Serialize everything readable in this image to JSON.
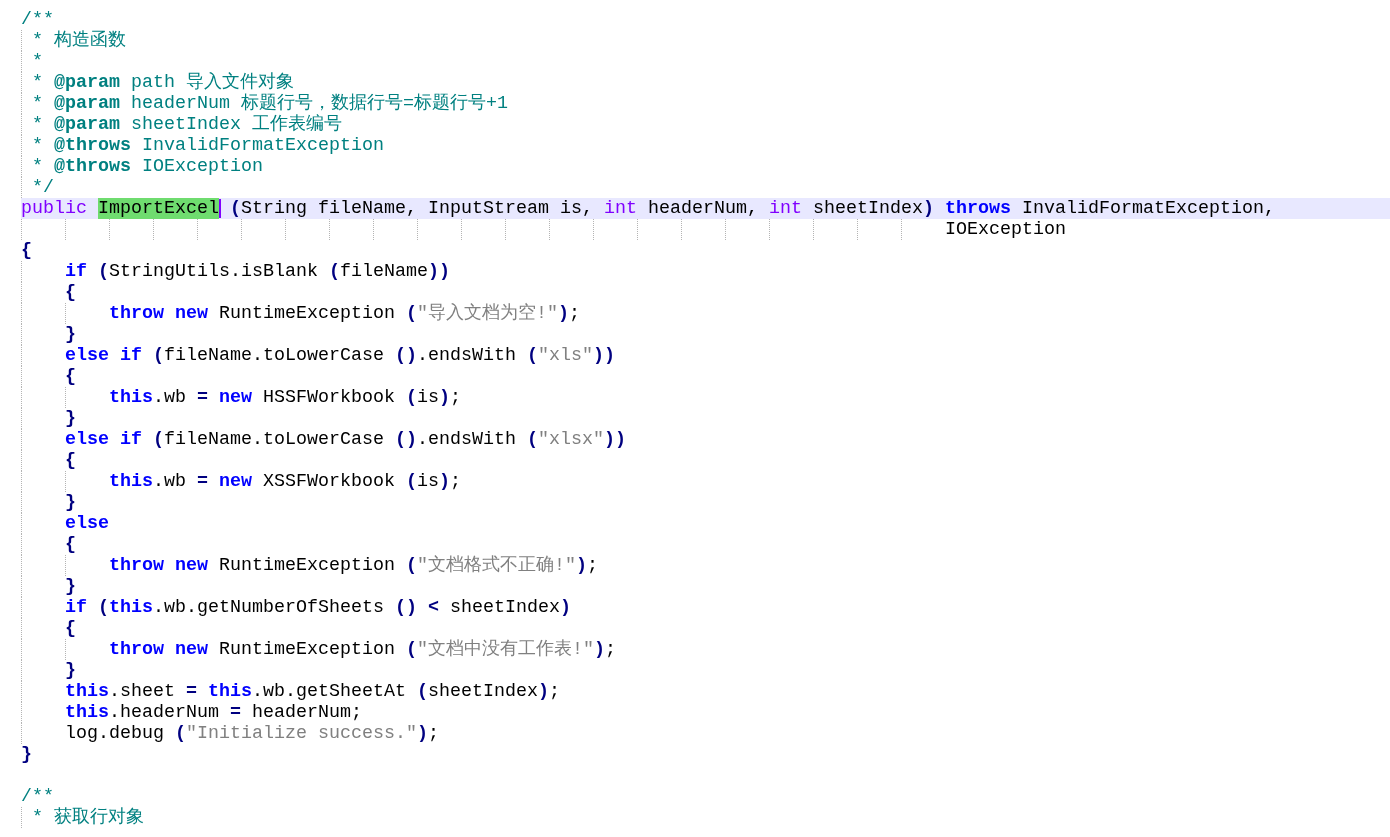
{
  "lines": [
    {
      "current": false,
      "tokens": [
        {
          "text": "/**",
          "kind": "comment"
        }
      ]
    },
    {
      "current": false,
      "tokens": [
        {
          "text": " * 构造函数",
          "kind": "comment"
        }
      ]
    },
    {
      "current": false,
      "tokens": [
        {
          "text": " *",
          "kind": "comment"
        }
      ]
    },
    {
      "current": false,
      "tokens": [
        {
          "text": " * ",
          "kind": "comment"
        },
        {
          "text": "@param",
          "kind": "tag"
        },
        {
          "text": " path 导入文件对象",
          "kind": "comment"
        }
      ]
    },
    {
      "current": false,
      "tokens": [
        {
          "text": " * ",
          "kind": "comment"
        },
        {
          "text": "@param",
          "kind": "tag"
        },
        {
          "text": " headerNum 标题行号，数据行号=标题行号+1",
          "kind": "comment"
        }
      ]
    },
    {
      "current": false,
      "tokens": [
        {
          "text": " * ",
          "kind": "comment"
        },
        {
          "text": "@param",
          "kind": "tag"
        },
        {
          "text": " sheetIndex 工作表编号",
          "kind": "comment"
        }
      ]
    },
    {
      "current": false,
      "tokens": [
        {
          "text": " * ",
          "kind": "comment"
        },
        {
          "text": "@throws",
          "kind": "tag"
        },
        {
          "text": " InvalidFormatException",
          "kind": "comment"
        }
      ]
    },
    {
      "current": false,
      "tokens": [
        {
          "text": " * ",
          "kind": "comment"
        },
        {
          "text": "@throws",
          "kind": "tag"
        },
        {
          "text": " IOException",
          "kind": "comment"
        }
      ]
    },
    {
      "current": false,
      "tokens": [
        {
          "text": " */",
          "kind": "comment"
        }
      ]
    },
    {
      "current": true,
      "tokens": [
        {
          "text": "public ",
          "kind": "type"
        },
        {
          "text": "ImportExcel",
          "kind": "match",
          "caret": true
        },
        {
          "text": " (",
          "kind": "op"
        },
        {
          "text": "String fileName, InputStream is, ",
          "kind": "plain"
        },
        {
          "text": "int",
          "kind": "type"
        },
        {
          "text": " headerNum, ",
          "kind": "plain"
        },
        {
          "text": "int",
          "kind": "type"
        },
        {
          "text": " sheetIndex",
          "kind": "plain"
        },
        {
          "text": ") ",
          "kind": "op"
        },
        {
          "text": "throws",
          "kind": "kw"
        },
        {
          "text": " InvalidFormatException,",
          "kind": "plain"
        }
      ]
    },
    {
      "current": false,
      "tokens": [
        {
          "text": "                                                                                    IOException",
          "kind": "plain"
        }
      ]
    },
    {
      "current": false,
      "tokens": [
        {
          "text": "{",
          "kind": "op"
        }
      ]
    },
    {
      "current": false,
      "tokens": [
        {
          "text": "    if ",
          "kind": "kw"
        },
        {
          "text": "(",
          "kind": "op"
        },
        {
          "text": "StringUtils.isBlank ",
          "kind": "plain"
        },
        {
          "text": "(",
          "kind": "op"
        },
        {
          "text": "fileName",
          "kind": "plain"
        },
        {
          "text": "))",
          "kind": "op"
        }
      ]
    },
    {
      "current": false,
      "tokens": [
        {
          "text": "    {",
          "kind": "op"
        }
      ]
    },
    {
      "current": false,
      "tokens": [
        {
          "text": "        throw new",
          "kind": "kw"
        },
        {
          "text": " RuntimeException ",
          "kind": "plain"
        },
        {
          "text": "(",
          "kind": "op"
        },
        {
          "text": "\"导入文档为空!\"",
          "kind": "str"
        },
        {
          "text": ")",
          "kind": "op"
        },
        {
          "text": ";",
          "kind": "plain"
        }
      ]
    },
    {
      "current": false,
      "tokens": [
        {
          "text": "    }",
          "kind": "op"
        }
      ]
    },
    {
      "current": false,
      "tokens": [
        {
          "text": "    else if ",
          "kind": "kw"
        },
        {
          "text": "(",
          "kind": "op"
        },
        {
          "text": "fileName.toLowerCase ",
          "kind": "plain"
        },
        {
          "text": "()",
          "kind": "op"
        },
        {
          "text": ".endsWith ",
          "kind": "plain"
        },
        {
          "text": "(",
          "kind": "op"
        },
        {
          "text": "\"xls\"",
          "kind": "str"
        },
        {
          "text": "))",
          "kind": "op"
        }
      ]
    },
    {
      "current": false,
      "tokens": [
        {
          "text": "    {",
          "kind": "op"
        }
      ]
    },
    {
      "current": false,
      "tokens": [
        {
          "text": "        this",
          "kind": "kw"
        },
        {
          "text": ".wb ",
          "kind": "plain"
        },
        {
          "text": "= ",
          "kind": "op"
        },
        {
          "text": "new",
          "kind": "kw"
        },
        {
          "text": " HSSFWorkbook ",
          "kind": "plain"
        },
        {
          "text": "(",
          "kind": "op"
        },
        {
          "text": "is",
          "kind": "plain"
        },
        {
          "text": ")",
          "kind": "op"
        },
        {
          "text": ";",
          "kind": "plain"
        }
      ]
    },
    {
      "current": false,
      "tokens": [
        {
          "text": "    }",
          "kind": "op"
        }
      ]
    },
    {
      "current": false,
      "tokens": [
        {
          "text": "    else if ",
          "kind": "kw"
        },
        {
          "text": "(",
          "kind": "op"
        },
        {
          "text": "fileName.toLowerCase ",
          "kind": "plain"
        },
        {
          "text": "()",
          "kind": "op"
        },
        {
          "text": ".endsWith ",
          "kind": "plain"
        },
        {
          "text": "(",
          "kind": "op"
        },
        {
          "text": "\"xlsx\"",
          "kind": "str"
        },
        {
          "text": "))",
          "kind": "op"
        }
      ]
    },
    {
      "current": false,
      "tokens": [
        {
          "text": "    {",
          "kind": "op"
        }
      ]
    },
    {
      "current": false,
      "tokens": [
        {
          "text": "        this",
          "kind": "kw"
        },
        {
          "text": ".wb ",
          "kind": "plain"
        },
        {
          "text": "= ",
          "kind": "op"
        },
        {
          "text": "new",
          "kind": "kw"
        },
        {
          "text": " XSSFWorkbook ",
          "kind": "plain"
        },
        {
          "text": "(",
          "kind": "op"
        },
        {
          "text": "is",
          "kind": "plain"
        },
        {
          "text": ")",
          "kind": "op"
        },
        {
          "text": ";",
          "kind": "plain"
        }
      ]
    },
    {
      "current": false,
      "tokens": [
        {
          "text": "    }",
          "kind": "op"
        }
      ]
    },
    {
      "current": false,
      "tokens": [
        {
          "text": "    else",
          "kind": "kw"
        }
      ]
    },
    {
      "current": false,
      "tokens": [
        {
          "text": "    {",
          "kind": "op"
        }
      ]
    },
    {
      "current": false,
      "tokens": [
        {
          "text": "        throw new",
          "kind": "kw"
        },
        {
          "text": " RuntimeException ",
          "kind": "plain"
        },
        {
          "text": "(",
          "kind": "op"
        },
        {
          "text": "\"文档格式不正确!\"",
          "kind": "str"
        },
        {
          "text": ")",
          "kind": "op"
        },
        {
          "text": ";",
          "kind": "plain"
        }
      ]
    },
    {
      "current": false,
      "tokens": [
        {
          "text": "    }",
          "kind": "op"
        }
      ]
    },
    {
      "current": false,
      "tokens": [
        {
          "text": "    if ",
          "kind": "kw"
        },
        {
          "text": "(",
          "kind": "op"
        },
        {
          "text": "this",
          "kind": "kw"
        },
        {
          "text": ".wb.getNumberOfSheets ",
          "kind": "plain"
        },
        {
          "text": "() <",
          "kind": "op"
        },
        {
          "text": " sheetIndex",
          "kind": "plain"
        },
        {
          "text": ")",
          "kind": "op"
        }
      ]
    },
    {
      "current": false,
      "tokens": [
        {
          "text": "    {",
          "kind": "op"
        }
      ]
    },
    {
      "current": false,
      "tokens": [
        {
          "text": "        throw new",
          "kind": "kw"
        },
        {
          "text": " RuntimeException ",
          "kind": "plain"
        },
        {
          "text": "(",
          "kind": "op"
        },
        {
          "text": "\"文档中没有工作表!\"",
          "kind": "str"
        },
        {
          "text": ")",
          "kind": "op"
        },
        {
          "text": ";",
          "kind": "plain"
        }
      ]
    },
    {
      "current": false,
      "tokens": [
        {
          "text": "    }",
          "kind": "op"
        }
      ]
    },
    {
      "current": false,
      "tokens": [
        {
          "text": "    this",
          "kind": "kw"
        },
        {
          "text": ".sheet ",
          "kind": "plain"
        },
        {
          "text": "= ",
          "kind": "op"
        },
        {
          "text": "this",
          "kind": "kw"
        },
        {
          "text": ".wb.getSheetAt ",
          "kind": "plain"
        },
        {
          "text": "(",
          "kind": "op"
        },
        {
          "text": "sheetIndex",
          "kind": "plain"
        },
        {
          "text": ")",
          "kind": "op"
        },
        {
          "text": ";",
          "kind": "plain"
        }
      ]
    },
    {
      "current": false,
      "tokens": [
        {
          "text": "    this",
          "kind": "kw"
        },
        {
          "text": ".headerNum ",
          "kind": "plain"
        },
        {
          "text": "=",
          "kind": "op"
        },
        {
          "text": " headerNum;",
          "kind": "plain"
        }
      ]
    },
    {
      "current": false,
      "tokens": [
        {
          "text": "    log.debug ",
          "kind": "plain"
        },
        {
          "text": "(",
          "kind": "op"
        },
        {
          "text": "\"Initialize success.\"",
          "kind": "str"
        },
        {
          "text": ")",
          "kind": "op"
        },
        {
          "text": ";",
          "kind": "plain"
        }
      ]
    },
    {
      "current": false,
      "tokens": [
        {
          "text": "}",
          "kind": "op"
        }
      ]
    },
    {
      "current": false
    },
    {
      "current": false,
      "tokens": [
        {
          "text": "/**",
          "kind": "comment"
        }
      ]
    },
    {
      "current": false,
      "tokens": [
        {
          "text": " * 获取行对象",
          "kind": "comment"
        }
      ]
    }
  ]
}
